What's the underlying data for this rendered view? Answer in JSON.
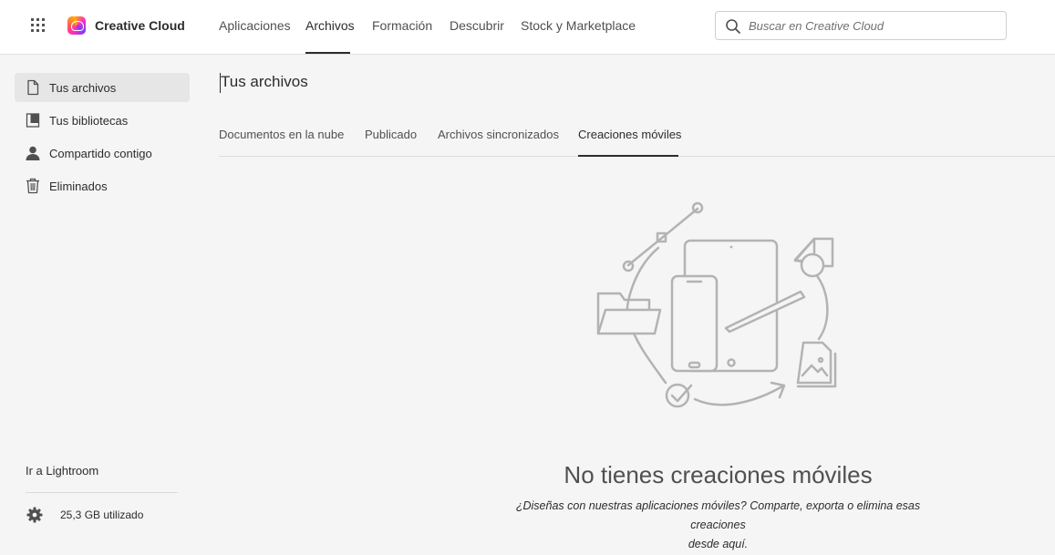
{
  "header": {
    "brand": "Creative Cloud",
    "nav": [
      "Aplicaciones",
      "Archivos",
      "Formación",
      "Descubrir",
      "Stock y Marketplace"
    ],
    "active_nav": "Archivos",
    "search_placeholder": "Buscar en Creative Cloud"
  },
  "sidebar": {
    "items": [
      {
        "label": "Tus archivos",
        "icon": "file-icon",
        "active": true
      },
      {
        "label": "Tus bibliotecas",
        "icon": "library-icon",
        "active": false
      },
      {
        "label": "Compartido contigo",
        "icon": "user-icon",
        "active": false
      },
      {
        "label": "Eliminados",
        "icon": "trash-icon",
        "active": false
      }
    ],
    "lightroom_link": "Ir a Lightroom",
    "storage": "25,3 GB utilizado"
  },
  "main": {
    "title": "Tus archivos",
    "tabs": [
      "Documentos en la nube",
      "Publicado",
      "Archivos sincronizados",
      "Creaciones móviles"
    ],
    "active_tab": "Creaciones móviles",
    "empty_title": "No tienes creaciones móviles",
    "empty_subtitle_line1": "¿Diseñas con nuestras aplicaciones móviles? Comparte, exporta o elimina esas creaciones",
    "empty_subtitle_line2": "desde aquí."
  },
  "colors": {
    "background": "#f5f5f5",
    "header_bg": "#ffffff",
    "active_item_bg": "#e6e6e6",
    "text": "#2c2c2c",
    "illustration_stroke": "#b3b3b3"
  }
}
